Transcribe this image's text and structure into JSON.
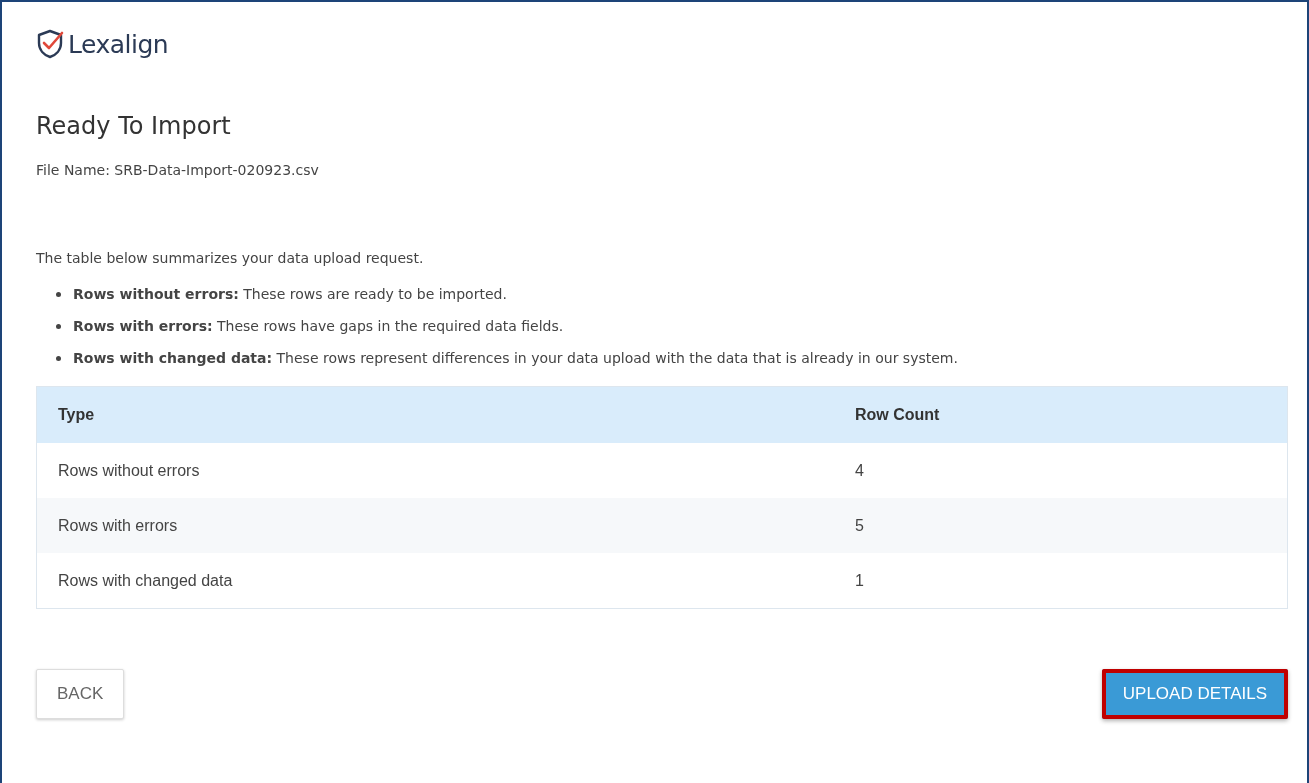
{
  "logo": {
    "text": "Lexalign"
  },
  "title": "Ready To Import",
  "file_name": "File Name: SRB-Data-Import-020923.csv",
  "intro": "The table below summarizes your data upload request.",
  "bullets": [
    "**Rows without errors:** These rows are ready to be imported.",
    "**Rows with errors:** These rows have gaps in the required data fields.",
    "**Rows with changed data:** These rows represent differences in your data upload with the data that is already in our system."
  ],
  "table": {
    "columns": [
      "Type",
      "Row Count"
    ],
    "rows": [
      [
        "Rows without errors",
        "4"
      ],
      [
        "Rows with errors",
        "5"
      ],
      [
        "Rows with changed data",
        "1"
      ]
    ]
  },
  "buttons": [
    {
      "label": "BACK",
      "kind": "secondary",
      "highlighted": false
    },
    {
      "label": "UPLOAD DETAILS",
      "kind": "primary",
      "highlighted": true
    }
  ]
}
